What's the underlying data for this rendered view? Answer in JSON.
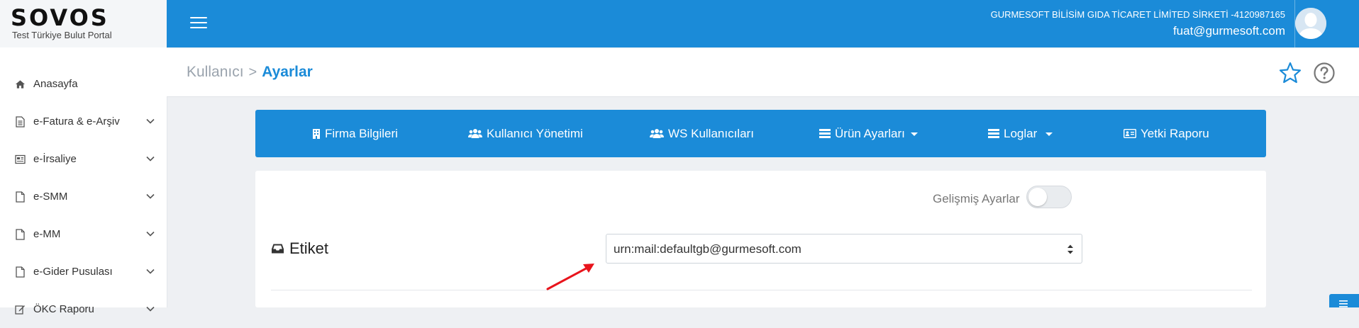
{
  "brand": {
    "logo": "SOVOS",
    "subtitle": "Test Türkiye Bulut Portal"
  },
  "sidebar": {
    "items": [
      {
        "label": "Anasayfa",
        "icon": "home-icon",
        "expandable": false
      },
      {
        "label": "e-Fatura & e-Arşiv",
        "icon": "document-icon",
        "expandable": true
      },
      {
        "label": "e-İrsaliye",
        "icon": "newspaper-icon",
        "expandable": true
      },
      {
        "label": "e-SMM",
        "icon": "file-icon",
        "expandable": true
      },
      {
        "label": "e-MM",
        "icon": "file-icon",
        "expandable": true
      },
      {
        "label": "e-Gider Pusulası",
        "icon": "file-icon",
        "expandable": true
      },
      {
        "label": "ÖKC Raporu",
        "icon": "edit-icon",
        "expandable": true
      }
    ]
  },
  "topbar": {
    "company": "GURMESOFT BİLİSİM GIDA TİCARET LİMİTED SİRKETİ -4120987165",
    "email": "fuat@gurmesoft.com"
  },
  "breadcrumb": {
    "parent": "Kullanıcı",
    "separator": ">",
    "current": "Ayarlar"
  },
  "tabs": [
    {
      "label": "Firma Bilgileri",
      "icon": "building-icon",
      "dropdown": false
    },
    {
      "label": "Kullanıcı Yönetimi",
      "icon": "users-icon",
      "dropdown": false
    },
    {
      "label": "WS Kullanıcıları",
      "icon": "users-icon",
      "dropdown": false
    },
    {
      "label": "Ürün Ayarları",
      "icon": "list-icon",
      "dropdown": true
    },
    {
      "label": "Loglar",
      "icon": "list-icon",
      "dropdown": true
    },
    {
      "label": "Yetki Raporu",
      "icon": "id-card-icon",
      "dropdown": false
    }
  ],
  "settings": {
    "advanced_label": "Gelişmiş Ayarlar",
    "advanced_enabled": false,
    "etiket_title": "Etiket",
    "etiket_value": "urn:mail:defaultgb@gurmesoft.com"
  },
  "colors": {
    "primary": "#1b8bd8",
    "annotation_arrow": "#e8141c"
  }
}
